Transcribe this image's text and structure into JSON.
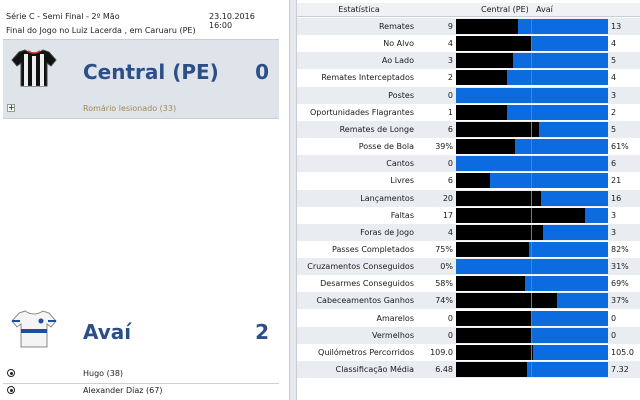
{
  "header": {
    "competition": "Série C - Semi Final - 2º Mão",
    "date": "23.10.2016 16:00",
    "result_text": "Final do Jogo no Luiz Lacerda , em Caruaru (PE)"
  },
  "home": {
    "name": "Central (PE)",
    "score": "0",
    "injury": "Romário lesionado (33)"
  },
  "away": {
    "name": "Avaí",
    "score": "2",
    "goals": [
      "Hugo (38)",
      "Alexander Díaz (67)"
    ]
  },
  "stats_header": {
    "stat": "Estatística",
    "home": "Central (PE)",
    "away": "Avaí"
  },
  "stats": [
    {
      "label": "Remates",
      "home": "9",
      "away": "13",
      "home_share": 0.41
    },
    {
      "label": "No Alvo",
      "home": "4",
      "away": "4",
      "home_share": 0.5
    },
    {
      "label": "Ao Lado",
      "home": "3",
      "away": "5",
      "home_share": 0.375
    },
    {
      "label": "Remates Interceptados",
      "home": "2",
      "away": "4",
      "home_share": 0.333
    },
    {
      "label": "Postes",
      "home": "0",
      "away": "3",
      "home_share": 0.0
    },
    {
      "label": "Oportunidades Flagrantes",
      "home": "1",
      "away": "2",
      "home_share": 0.333
    },
    {
      "label": "Remates de Longe",
      "home": "6",
      "away": "5",
      "home_share": 0.545
    },
    {
      "label": "Posse de Bola",
      "home": "39%",
      "away": "61%",
      "home_share": 0.39
    },
    {
      "label": "Cantos",
      "home": "0",
      "away": "6",
      "home_share": 0.0
    },
    {
      "label": "Livres",
      "home": "6",
      "away": "21",
      "home_share": 0.222
    },
    {
      "label": "Lançamentos",
      "home": "20",
      "away": "16",
      "home_share": 0.556
    },
    {
      "label": "Faltas",
      "home": "17",
      "away": "3",
      "home_share": 0.85
    },
    {
      "label": "Foras de Jogo",
      "home": "4",
      "away": "3",
      "home_share": 0.571
    },
    {
      "label": "Passes Completados",
      "home": "75%",
      "away": "82%",
      "home_share": 0.478
    },
    {
      "label": "Cruzamentos Conseguidos",
      "home": "0%",
      "away": "31%",
      "home_share": 0.0
    },
    {
      "label": "Desarmes Conseguidos",
      "home": "58%",
      "away": "69%",
      "home_share": 0.457
    },
    {
      "label": "Cabeceamentos Ganhos",
      "home": "74%",
      "away": "37%",
      "home_share": 0.667
    },
    {
      "label": "Amarelos",
      "home": "0",
      "away": "0",
      "home_share": 0.5
    },
    {
      "label": "Vermelhos",
      "home": "0",
      "away": "0",
      "home_share": 0.5
    },
    {
      "label": "Quilómetros Percorridos",
      "home": "109.0",
      "away": "105.0",
      "home_share": 0.509
    },
    {
      "label": "Classificação Média",
      "home": "6.48",
      "away": "7.32",
      "home_share": 0.47
    }
  ],
  "colors": {
    "home_bar": "#000000",
    "away_bar": "#0d6be0",
    "team_name": "#2c4f8a"
  }
}
